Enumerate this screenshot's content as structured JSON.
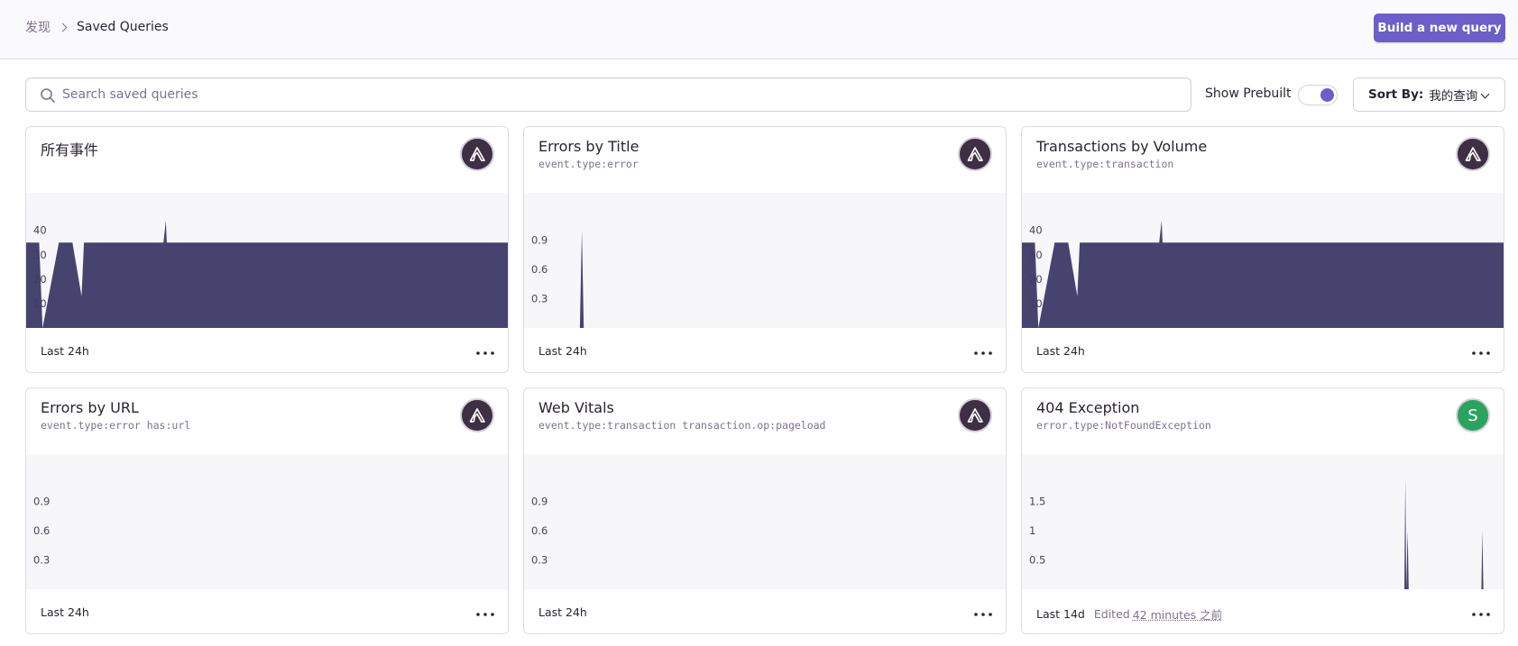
{
  "header": {
    "breadcrumb": {
      "parent": "发现",
      "current": "Saved Queries"
    },
    "build_button": "Build a new query"
  },
  "search": {
    "placeholder": "Search saved queries",
    "value": ""
  },
  "prebuilt": {
    "label": "Show Prebuilt",
    "enabled": true
  },
  "sort": {
    "label": "Sort By:",
    "value": "我的查询"
  },
  "colors": {
    "accent": "#6c5fc7",
    "chart": "#3e3b68",
    "avatar_bg": "#3e2f45",
    "avatar_letter_bg": "#2ba35f"
  },
  "cards": [
    {
      "title": "所有事件",
      "query": "",
      "avatar": "sentry-logo-icon",
      "range": "Last 24h",
      "chart_data": {
        "type": "area",
        "yticks": [
          "40",
          "30",
          "20",
          "10"
        ],
        "ymax": 48,
        "x": [
          0,
          1,
          2.7,
          3.4,
          3.4,
          6.8,
          7.1,
          9.6,
          11.5,
          12,
          12.3,
          12.8,
          28.5,
          29,
          29.2,
          29.7,
          100,
          100.5
        ],
        "y": [
          35,
          35,
          35,
          0,
          0,
          35,
          35,
          35,
          13,
          35,
          35,
          35,
          35,
          44,
          35,
          35,
          35,
          0
        ]
      }
    },
    {
      "title": "Errors by Title",
      "query": "event.type:error",
      "avatar": "sentry-logo-icon",
      "range": "Last 24h",
      "chart_data": {
        "type": "area",
        "yticks": [
          "0.9",
          "0.6",
          "0.3"
        ],
        "ymax": 1.2,
        "x": [
          0,
          11.6,
          12,
          12.4,
          100
        ],
        "y": [
          0,
          0,
          1,
          0,
          0
        ]
      }
    },
    {
      "title": "Transactions by Volume",
      "query": "event.type:transaction",
      "avatar": "sentry-logo-icon",
      "range": "Last 24h",
      "chart_data": {
        "type": "area",
        "yticks": [
          "40",
          "30",
          "20",
          "10"
        ],
        "ymax": 48,
        "x": [
          0,
          1,
          2.7,
          3.4,
          3.4,
          6.8,
          7.1,
          9.6,
          11.5,
          12,
          12.3,
          12.8,
          28.5,
          29,
          29.2,
          29.7,
          100,
          100.5
        ],
        "y": [
          35,
          35,
          35,
          0,
          0,
          35,
          35,
          35,
          13,
          35,
          35,
          35,
          35,
          44,
          35,
          35,
          35,
          0
        ]
      }
    },
    {
      "title": "Errors by URL",
      "query": "event.type:error has:url",
      "avatar": "sentry-logo-icon",
      "range": "Last 24h",
      "chart_data": {
        "type": "area",
        "yticks": [
          "0.9",
          "0.6",
          "0.3"
        ],
        "ymax": 1.2,
        "x": [
          0,
          100
        ],
        "y": [
          0,
          0
        ]
      }
    },
    {
      "title": "Web Vitals",
      "query": "event.type:transaction transaction.op:pageload",
      "avatar": "sentry-logo-icon",
      "range": "Last 24h",
      "chart_data": {
        "type": "area",
        "yticks": [
          "0.9",
          "0.6",
          "0.3"
        ],
        "ymax": 1.2,
        "x": [
          0,
          100
        ],
        "y": [
          0,
          0
        ]
      }
    },
    {
      "title": "404 Exception",
      "query": "error.type:NotFoundException",
      "avatar": "S",
      "range": "Last 14d",
      "edited_label": "Edited",
      "edited_when": "42 minutes 之前",
      "chart_data": {
        "type": "area",
        "yticks": [
          "1.5",
          "1",
          "0.5"
        ],
        "ymax": 2.0,
        "x": [
          0,
          79.4,
          79.6,
          79.8,
          80.1,
          80.3,
          95.4,
          95.6,
          95.8,
          100
        ],
        "y": [
          0,
          0,
          1.9,
          0,
          1,
          0,
          0,
          1,
          0,
          0
        ]
      }
    }
  ]
}
